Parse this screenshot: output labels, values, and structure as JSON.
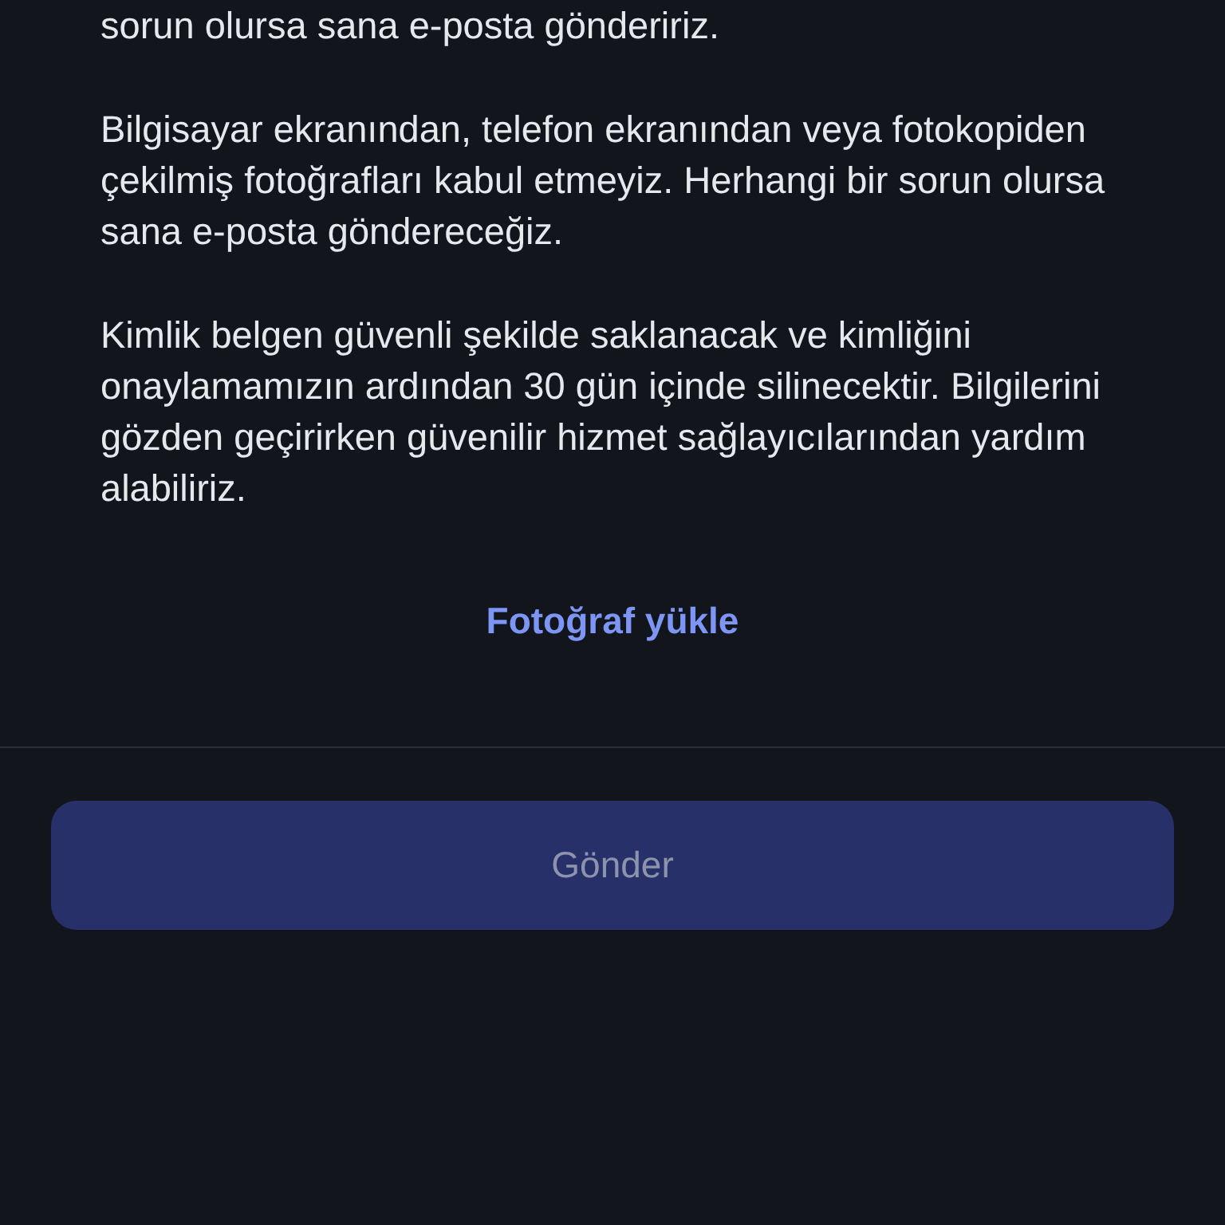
{
  "paragraphs": [
    "sorun olursa sana e-posta göndeririz.",
    "Bilgisayar ekranından, telefon ekranından veya fotokopiden çekilmiş fotoğrafları kabul etmeyiz. Herhangi bir sorun olursa sana e-posta göndereceğiz.",
    "Kimlik belgen güvenli şekilde saklanacak ve kimliğini onaylamamızın ardından 30 gün içinde silinecektir. Bilgilerini gözden geçirirken güvenilir hizmet sağlayıcılarından yardım alabiliriz."
  ],
  "upload_link": "Fotoğraf yükle",
  "submit_button": {
    "label": "Gönder",
    "disabled": true
  }
}
